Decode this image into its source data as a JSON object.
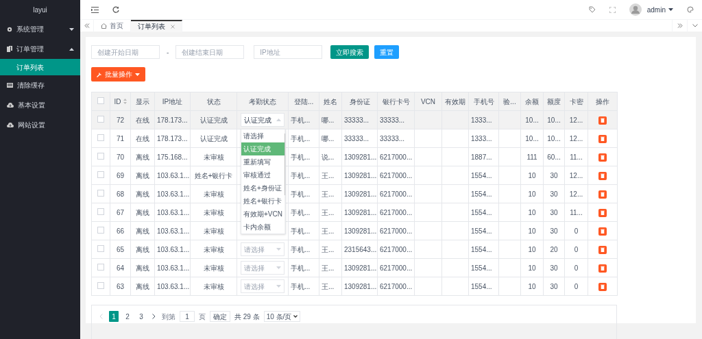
{
  "sidebar": {
    "logo": "layui",
    "items": [
      {
        "label": "系统管理",
        "expanded": false,
        "selected": false
      },
      {
        "label": "订单管理",
        "expanded": true,
        "selected": false,
        "children": [
          {
            "label": "订单列表",
            "selected": true
          }
        ]
      },
      {
        "label": "清除缓存",
        "selected": false
      },
      {
        "label": "基本设置",
        "selected": false
      },
      {
        "label": "网站设置",
        "selected": false
      }
    ]
  },
  "header": {
    "user": "admin"
  },
  "tabs": [
    {
      "label": "首页",
      "selected": false,
      "closable": false
    },
    {
      "label": "订单列表",
      "selected": true,
      "closable": true
    }
  ],
  "search": {
    "fields": [
      {
        "placeholder": "创建开始日期"
      },
      {
        "placeholder": "创建结束日期"
      },
      {
        "placeholder": "IP地址"
      }
    ],
    "separator": "-",
    "buttons": [
      {
        "label": "立即搜索",
        "kind": "primary"
      },
      {
        "label": "重置",
        "kind": "normal"
      }
    ]
  },
  "batch_button": "批量操作",
  "table": {
    "header_checked": false,
    "columns": [
      {
        "label": "ID",
        "sortable": true
      },
      {
        "label": "显示"
      },
      {
        "label": "IP地址"
      },
      {
        "label": "状态"
      },
      {
        "label": "考勤状态"
      },
      {
        "label": "登陆..."
      },
      {
        "label": "姓名"
      },
      {
        "label": "身份证"
      },
      {
        "label": "银行卡号"
      },
      {
        "label": "VCN"
      },
      {
        "label": "有效期"
      },
      {
        "label": "手机号"
      },
      {
        "label": "验..."
      },
      {
        "label": "余额"
      },
      {
        "label": "额度"
      },
      {
        "label": "卡密"
      },
      {
        "label": "操作"
      }
    ],
    "rows": [
      {
        "checked": false,
        "highlighted": true,
        "cells": [
          "72",
          "在线",
          "178.173...",
          "认证完成",
          {
            "value": "认证完成",
            "placeholder": false,
            "open": true,
            "options": [
              {
                "label": "请选择",
                "selected": false
              },
              {
                "label": "认证完成",
                "selected": true
              },
              {
                "label": "重新填写",
                "selected": false
              },
              {
                "label": "审核通过",
                "selected": false
              },
              {
                "label": "姓名+身份证",
                "selected": false
              },
              {
                "label": "姓名+银行卡",
                "selected": false
              },
              {
                "label": "有效期+VCN",
                "selected": false
              },
              {
                "label": "卡内余额",
                "selected": false
              }
            ]
          },
          "手机...",
          "哪...",
          "33333...",
          "33333...",
          null,
          null,
          "1333...",
          null,
          "10...",
          "10...",
          "12..."
        ]
      },
      {
        "checked": false,
        "highlighted": false,
        "cells": [
          "71",
          "在线",
          "178.173...",
          "认证完成",
          null,
          "手机...",
          "哪...",
          "33333...",
          "33333...",
          null,
          null,
          "1333...",
          null,
          "10...",
          "10...",
          "12..."
        ]
      },
      {
        "checked": false,
        "highlighted": false,
        "cells": [
          "70",
          "离线",
          "175.168...",
          "未审核",
          null,
          "手机...",
          "说...",
          "1309281...",
          "6217000...",
          null,
          null,
          "1887...",
          null,
          "111",
          "60...",
          "11..."
        ]
      },
      {
        "checked": false,
        "highlighted": false,
        "cells": [
          "69",
          "离线",
          "103.63.1...",
          "姓名+银行卡",
          null,
          "手机...",
          "王...",
          "1309281...",
          "6217000...",
          null,
          null,
          "1554...",
          null,
          "10",
          "30",
          "12..."
        ]
      },
      {
        "checked": false,
        "highlighted": false,
        "cells": [
          "68",
          "离线",
          "103.63.1...",
          "未审核",
          null,
          "手机...",
          "王...",
          "1309281...",
          "6217000...",
          null,
          null,
          "1554...",
          null,
          "10",
          "30",
          "12..."
        ]
      },
      {
        "checked": false,
        "highlighted": false,
        "cells": [
          "67",
          "离线",
          "103.63.1...",
          "未审核",
          null,
          "手机...",
          "王...",
          "1309281...",
          "6217000...",
          null,
          null,
          "1554...",
          null,
          "10",
          "30",
          "11..."
        ]
      },
      {
        "checked": false,
        "highlighted": false,
        "cells": [
          "66",
          "离线",
          "103.63.1...",
          "未审核",
          null,
          "手机...",
          "王...",
          "1309281...",
          "6217000...",
          null,
          null,
          "1554...",
          null,
          "10",
          "30",
          "0"
        ]
      },
      {
        "checked": false,
        "highlighted": false,
        "cells": [
          "65",
          "离线",
          "103.63.1...",
          "未审核",
          {
            "value": "请选择",
            "placeholder": true,
            "open": false
          },
          "手机...",
          "王...",
          "2315643...",
          "6217000...",
          null,
          null,
          "1554...",
          null,
          "10",
          "20",
          "0"
        ]
      },
      {
        "checked": false,
        "highlighted": false,
        "cells": [
          "64",
          "离线",
          "103.63.1...",
          "未审核",
          {
            "value": "请选择",
            "placeholder": true,
            "open": false
          },
          "手机...",
          "王...",
          "1309281...",
          "6217000...",
          null,
          null,
          "1554...",
          null,
          "10",
          "30",
          "0"
        ]
      },
      {
        "checked": false,
        "highlighted": false,
        "cells": [
          "63",
          "离线",
          "103.63.1...",
          "未审核",
          {
            "value": "请选择",
            "placeholder": true,
            "open": false
          },
          "手机...",
          "王...",
          "1309281...",
          "6217000...",
          null,
          null,
          "1554...",
          null,
          "10",
          "30",
          "0"
        ]
      }
    ]
  },
  "pagination": {
    "prev_disabled": true,
    "next_disabled": false,
    "pages": [
      {
        "label": "1",
        "selected": true
      },
      {
        "label": "2",
        "selected": false
      },
      {
        "label": "3",
        "selected": false
      }
    ],
    "goto_label": "到第",
    "goto_value": "1",
    "page_unit": "页",
    "confirm": "确定",
    "total": "共 29 条",
    "page_size": "10 条/页"
  }
}
